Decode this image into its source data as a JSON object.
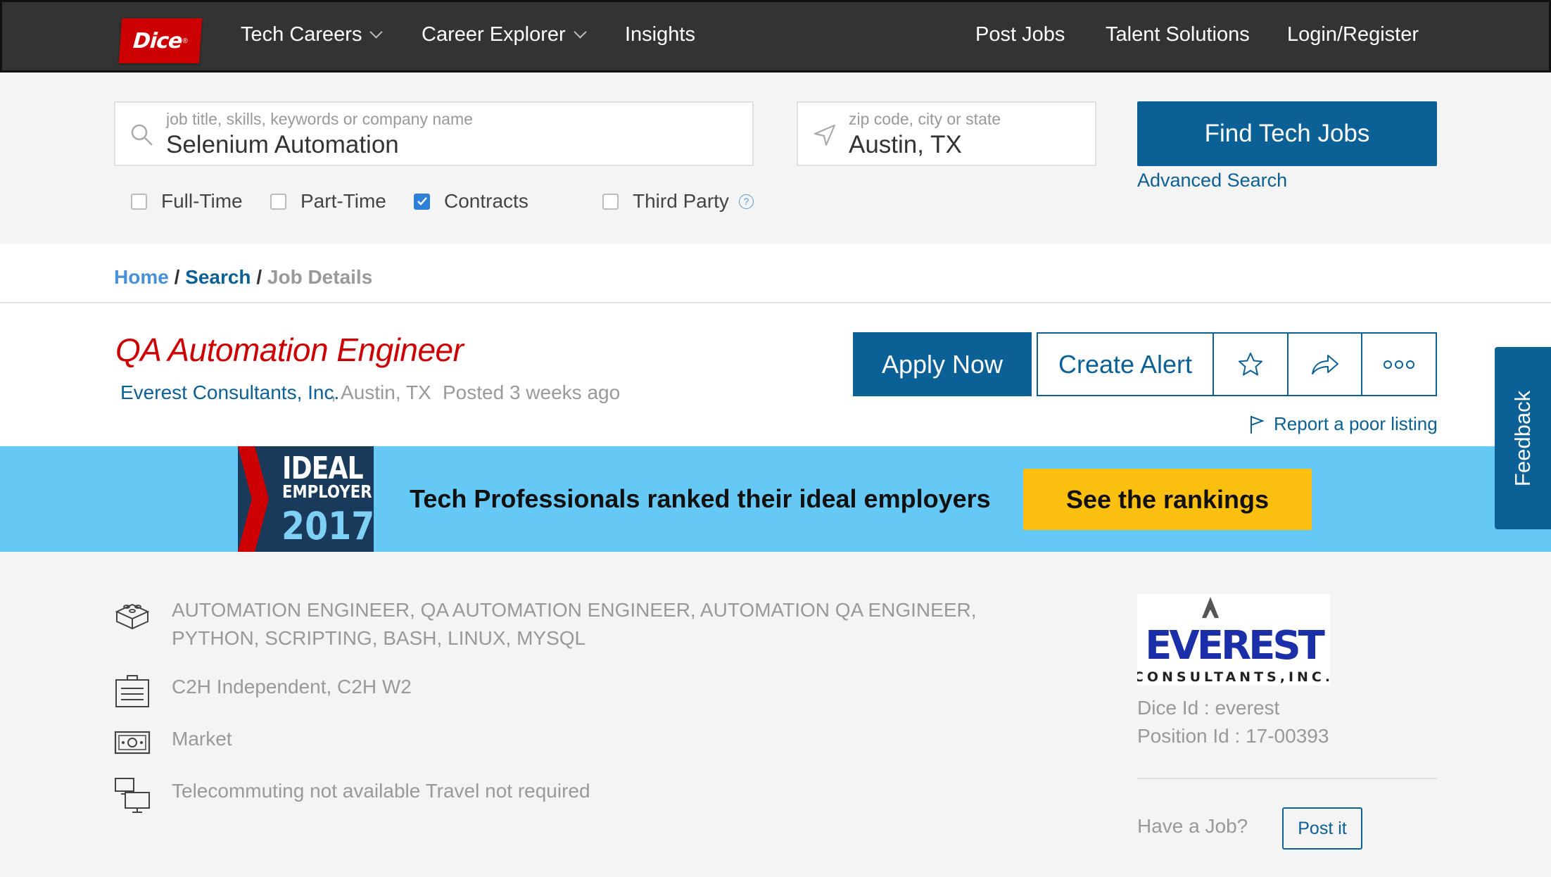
{
  "nav": {
    "logo_text": "Dice",
    "logo_mark": "®",
    "items": [
      "Tech Careers",
      "Career Explorer",
      "Insights"
    ],
    "right_items": [
      "Post Jobs",
      "Talent Solutions",
      "Login/Register"
    ]
  },
  "search": {
    "keyword_placeholder": "job title, skills, keywords or company name",
    "keyword_value": "Selenium Automation",
    "location_placeholder": "zip code, city or state",
    "location_value": "Austin, TX",
    "find_button": "Find Tech Jobs",
    "advanced_link": "Advanced Search",
    "filters": [
      {
        "label": "Full-Time",
        "checked": false
      },
      {
        "label": "Part-Time",
        "checked": false
      },
      {
        "label": "Contracts",
        "checked": true
      },
      {
        "label": "Third Party",
        "checked": false
      }
    ]
  },
  "breadcrumb": {
    "home": "Home",
    "search": "Search",
    "current": "Job Details",
    "separator": "/"
  },
  "job": {
    "title": "QA Automation Engineer",
    "company": "Everest Consultants, Inc.",
    "location": ", Austin, TX",
    "posted": "Posted 3 weeks ago",
    "apply_button": "Apply Now",
    "alert_button": "Create Alert",
    "report_link": "Report a poor listing"
  },
  "banner": {
    "badge_line1": "IDEAL",
    "badge_line2": "EMPLOYER",
    "badge_year": "2017",
    "text": "Tech Professionals ranked their ideal employers",
    "button": "See the rankings"
  },
  "feedback": "Feedback",
  "details": {
    "skills": "AUTOMATION ENGINEER, QA AUTOMATION ENGINEER, AUTOMATION QA ENGINEER, PYTHON, SCRIPTING, BASH, LINUX, MYSQL",
    "employment_type": "C2H Independent, C2H W2",
    "salary": "Market",
    "telecommute": "Telecommuting not available Travel not required"
  },
  "sidebar": {
    "logo_main": "EVEREST",
    "logo_sub": "CONSULTANTS,INC.",
    "dice_id": "Dice Id : everest",
    "position_id": "Position Id : 17-00393",
    "have_job": "Have a Job?",
    "post_button": "Post it"
  },
  "colors": {
    "brand_red": "#cc0000",
    "primary_blue": "#0b6096",
    "banner_blue": "#66c8f5",
    "cta_yellow": "#fbbf0f"
  }
}
